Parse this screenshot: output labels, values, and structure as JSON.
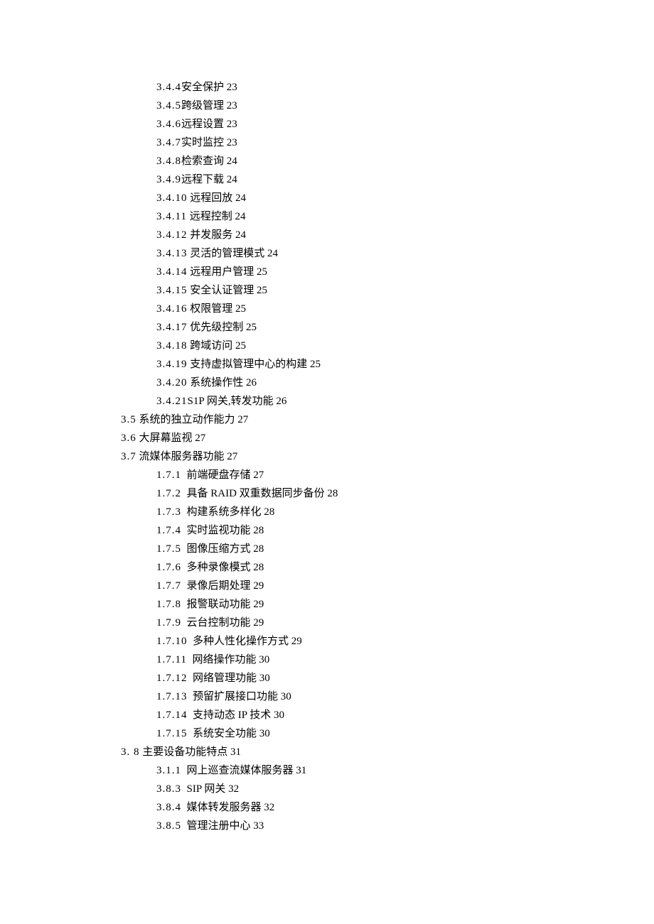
{
  "items": [
    {
      "cls": "lvl-a",
      "num": "3.4.4",
      "title": "安全保护",
      "page": "23",
      "sp": ""
    },
    {
      "cls": "lvl-a",
      "num": "3.4.5",
      "title": "跨级管理",
      "page": "23",
      "sp": ""
    },
    {
      "cls": "lvl-a",
      "num": "3.4.6",
      "title": "远程设置",
      "page": "23",
      "sp": ""
    },
    {
      "cls": "lvl-a",
      "num": "3.4.7",
      "title": "实时监控",
      "page": "23",
      "sp": ""
    },
    {
      "cls": "lvl-a",
      "num": "3.4.8",
      "title": "检索查询",
      "page": "24",
      "sp": ""
    },
    {
      "cls": "lvl-a",
      "num": "3.4.9",
      "title": "远程下载",
      "page": "24",
      "sp": ""
    },
    {
      "cls": "lvl-a",
      "num": "3.4.10",
      "title": "远程回放",
      "page": "24",
      "sp": " "
    },
    {
      "cls": "lvl-a",
      "num": "3.4.11",
      "title": "远程控制",
      "page": "24",
      "sp": " "
    },
    {
      "cls": "lvl-a",
      "num": "3.4.12",
      "title": "并发服务",
      "page": "24",
      "sp": " "
    },
    {
      "cls": "lvl-a",
      "num": "3.4.13",
      "title": "灵活的管理模式",
      "page": "24",
      "sp": " "
    },
    {
      "cls": "lvl-a",
      "num": "3.4.14",
      "title": "远程用户管理",
      "page": "25",
      "sp": " "
    },
    {
      "cls": "lvl-a",
      "num": "3.4.15",
      "title": "安全认证管理",
      "page": "25",
      "sp": " "
    },
    {
      "cls": "lvl-a",
      "num": "3.4.16",
      "title": "权限管理",
      "page": "25",
      "sp": " "
    },
    {
      "cls": "lvl-a",
      "num": "3.4.17",
      "title": "优先级控制",
      "page": "25",
      "sp": " "
    },
    {
      "cls": "lvl-a",
      "num": "3.4.18",
      "title": "跨域访问",
      "page": "25",
      "sp": " "
    },
    {
      "cls": "lvl-a",
      "num": "3.4.19",
      "title": "支持虚拟管理中心的构建",
      "page": "25",
      "sp": " "
    },
    {
      "cls": "lvl-a",
      "num": "3.4.20",
      "title": "系统操作性",
      "page": "26",
      "sp": " "
    },
    {
      "cls": "lvl-a",
      "num": "3.4.21",
      "title": "S1P 网关,转发功能",
      "page": "26",
      "sp": ""
    },
    {
      "cls": "lvl-b",
      "num": "3.5",
      "title": "系统的独立动作能力",
      "page": "27",
      "sp": " "
    },
    {
      "cls": "lvl-b",
      "num": "3.6",
      "title": "大屏幕监视",
      "page": "27",
      "sp": " "
    },
    {
      "cls": "lvl-b",
      "num": "3.7",
      "title": "流媒体服务器功能",
      "page": "27",
      "sp": " "
    },
    {
      "cls": "lvl-a",
      "num": "1.7.1",
      "title": " 前端硬盘存储",
      "page": "27",
      "sp": " "
    },
    {
      "cls": "lvl-a",
      "num": "1.7.2",
      "title": " 具备 RAID 双重数据同步备份",
      "page": "28",
      "sp": " "
    },
    {
      "cls": "lvl-a",
      "num": "1.7.3",
      "title": " 构建系统多样化",
      "page": "28",
      "sp": " "
    },
    {
      "cls": "lvl-a",
      "num": "1.7.4",
      "title": " 实时监视功能",
      "page": "28",
      "sp": " "
    },
    {
      "cls": "lvl-a",
      "num": "1.7.5",
      "title": " 图像压缩方式",
      "page": "28",
      "sp": " "
    },
    {
      "cls": "lvl-a",
      "num": "1.7.6",
      "title": " 多种录像模式",
      "page": "28",
      "sp": " "
    },
    {
      "cls": "lvl-a",
      "num": "1.7.7",
      "title": " 录像后期处理",
      "page": "29",
      "sp": " "
    },
    {
      "cls": "lvl-a",
      "num": "1.7.8",
      "title": " 报警联动功能",
      "page": "29",
      "sp": " "
    },
    {
      "cls": "lvl-a",
      "num": "1.7.9",
      "title": " 云台控制功能",
      "page": "29",
      "sp": " "
    },
    {
      "cls": "lvl-a",
      "num": "1.7.10",
      "title": " 多种人性化操作方式",
      "page": "29",
      "sp": " "
    },
    {
      "cls": "lvl-a",
      "num": "1.7.11",
      "title": " 网络操作功能",
      "page": "30",
      "sp": " "
    },
    {
      "cls": "lvl-a",
      "num": "1.7.12",
      "title": " 网络管理功能",
      "page": "30",
      "sp": " "
    },
    {
      "cls": "lvl-a",
      "num": "1.7.13",
      "title": " 预留扩展接口功能",
      "page": "30",
      "sp": " "
    },
    {
      "cls": "lvl-a",
      "num": "1.7.14",
      "title": " 支持动态 IP 技术",
      "page": "30",
      "sp": " "
    },
    {
      "cls": "lvl-a",
      "num": "1.7.15",
      "title": " 系统安全功能",
      "page": "30",
      "sp": " "
    },
    {
      "cls": "lvl-b",
      "num": "3. 8",
      "title": "主要设备功能特点",
      "page": "31",
      "sp": " "
    },
    {
      "cls": "lvl-a",
      "num": "3.1.1",
      "title": " 网上巡查流媒体服务器",
      "page": "31",
      "sp": " "
    },
    {
      "cls": "lvl-a",
      "num": "3.8.3",
      "title": " SIP 网关",
      "page": "32",
      "sp": " "
    },
    {
      "cls": "lvl-a",
      "num": "3.8.4",
      "title": " 媒体转发服务器",
      "page": "32",
      "sp": " "
    },
    {
      "cls": "lvl-a",
      "num": "3.8.5",
      "title": " 管理注册中心",
      "page": "33",
      "sp": " "
    }
  ]
}
